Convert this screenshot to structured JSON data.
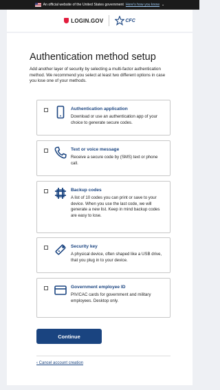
{
  "banner": {
    "text": "An official website of the United States government",
    "link": "Here's how you know",
    "chevron": "⌄"
  },
  "logos": {
    "login": "LOGIN.GOV",
    "cfc": "CFC"
  },
  "page": {
    "title": "Authentication method setup",
    "intro": "Add another layer of security by selecting a multi-factor authentication method. We recommend you select at least two different options in case you lose one of your methods."
  },
  "options": [
    {
      "title": "Authentication application",
      "desc": "Download or use an authentication app of your choice to generate secure codes.",
      "icon": "phone-app-icon"
    },
    {
      "title": "Text or voice message",
      "desc": "Receive a secure code by (SMS) text or phone call.",
      "icon": "phone-handset-icon"
    },
    {
      "title": "Backup codes",
      "desc": "A list of 10 codes you can print or save to your device. When you use the last code, we will generate a new list. Keep in mind backup codes are easy to lose.",
      "icon": "backup-codes-icon"
    },
    {
      "title": "Security key",
      "desc": "A physical device, often shaped like a USB drive, that you plug in to your device.",
      "icon": "security-key-icon"
    },
    {
      "title": "Government employee ID",
      "desc": "PIV/CAC cards for government and military employees. Desktop only.",
      "icon": "id-card-icon"
    }
  ],
  "actions": {
    "continue": "Continue",
    "cancel": "‹ Cancel account creation"
  },
  "colors": {
    "primary": "#1a4480",
    "banner_bg": "#1b1b1b",
    "login_red": "#e21c3d"
  }
}
